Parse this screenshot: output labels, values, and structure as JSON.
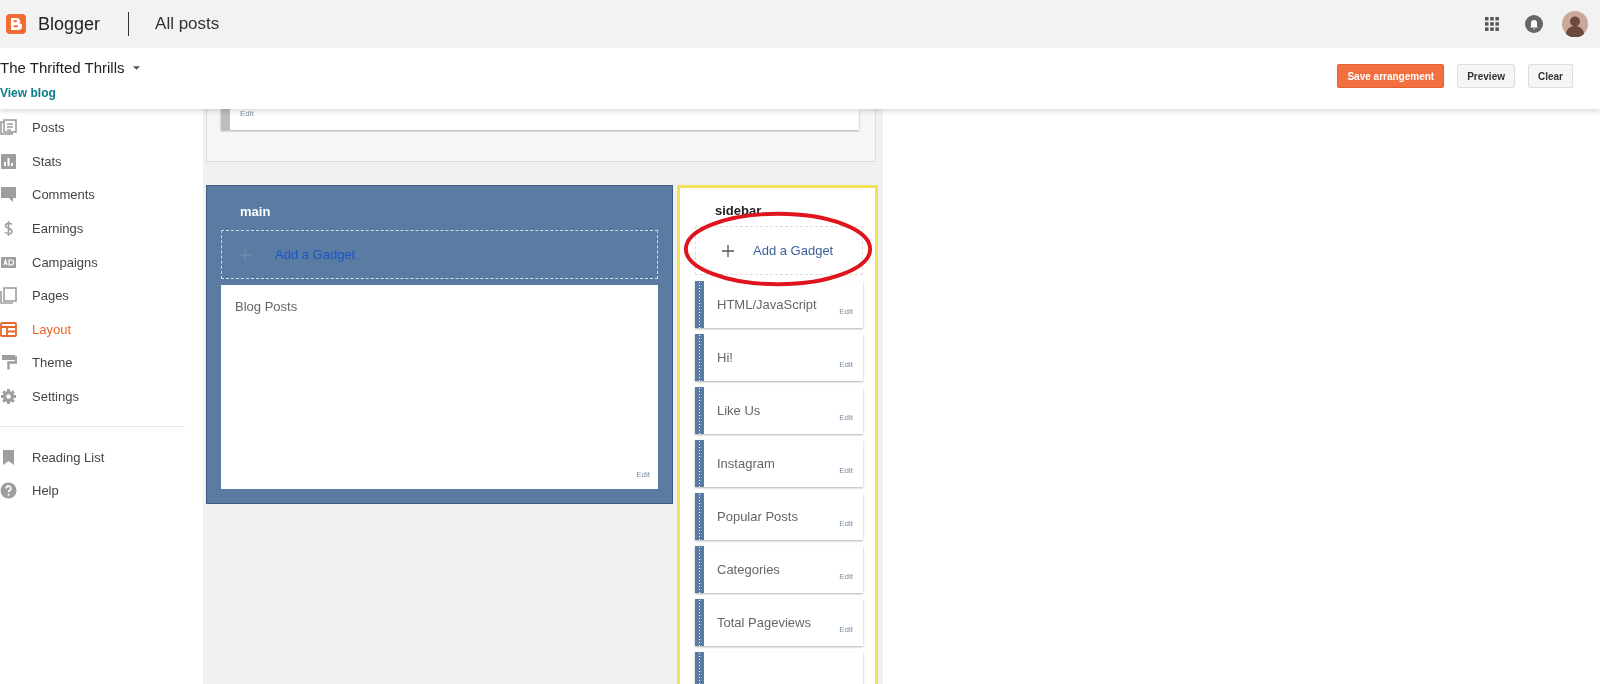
{
  "app": {
    "name": "Blogger",
    "page_title": "All posts"
  },
  "blog": {
    "title": "The Thrifted Thrills",
    "view_link": "View blog"
  },
  "actions": [
    {
      "label": "Save arrangement",
      "kind": "primary"
    },
    {
      "label": "Preview",
      "kind": "secondary"
    },
    {
      "label": "Clear",
      "kind": "secondary"
    }
  ],
  "nav": [
    {
      "label": "Posts",
      "kind": "posts",
      "selected": false
    },
    {
      "label": "Stats",
      "kind": "stats",
      "selected": false
    },
    {
      "label": "Comments",
      "kind": "comments",
      "selected": false
    },
    {
      "label": "Earnings",
      "kind": "earnings",
      "selected": false
    },
    {
      "label": "Campaigns",
      "kind": "campaigns",
      "selected": false
    },
    {
      "label": "Pages",
      "kind": "pages",
      "selected": false
    },
    {
      "label": "Layout",
      "kind": "layout",
      "selected": true
    },
    {
      "label": "Theme",
      "kind": "theme",
      "selected": false
    },
    {
      "label": "Settings",
      "kind": "settings",
      "selected": false
    }
  ],
  "nav_secondary": [
    {
      "label": "Reading List",
      "kind": "bookmark",
      "selected": false
    },
    {
      "label": "Help",
      "kind": "help",
      "selected": false
    }
  ],
  "layout": {
    "top_section": {
      "gadgets": [
        {
          "edit": "Edit"
        }
      ]
    },
    "sections": [
      {
        "title": "main",
        "active": true,
        "highlighted": false,
        "add_gadget": "Add a Gadget",
        "gadgets": [
          {
            "kind": "full",
            "name": "Blog Posts",
            "edit": "Edit"
          }
        ]
      },
      {
        "title": "sidebar",
        "active": false,
        "highlighted": true,
        "add_gadget": "Add a Gadget",
        "annotation": {
          "kind": "ellipse"
        },
        "gadgets": [
          {
            "kind": "full",
            "name": "HTML/JavaScript",
            "edit": "Edit"
          },
          {
            "kind": "full",
            "name": "Hi!",
            "edit": "Edit"
          },
          {
            "kind": "full",
            "name": "Like Us",
            "edit": "Edit"
          },
          {
            "kind": "full",
            "name": "Instagram",
            "edit": "Edit"
          },
          {
            "kind": "full",
            "name": "Popular Posts",
            "edit": "Edit"
          },
          {
            "kind": "full",
            "name": "Categories",
            "edit": "Edit"
          },
          {
            "kind": "full",
            "name": "Total Pageviews",
            "edit": "Edit"
          },
          {
            "kind": "partial"
          }
        ]
      }
    ]
  }
}
